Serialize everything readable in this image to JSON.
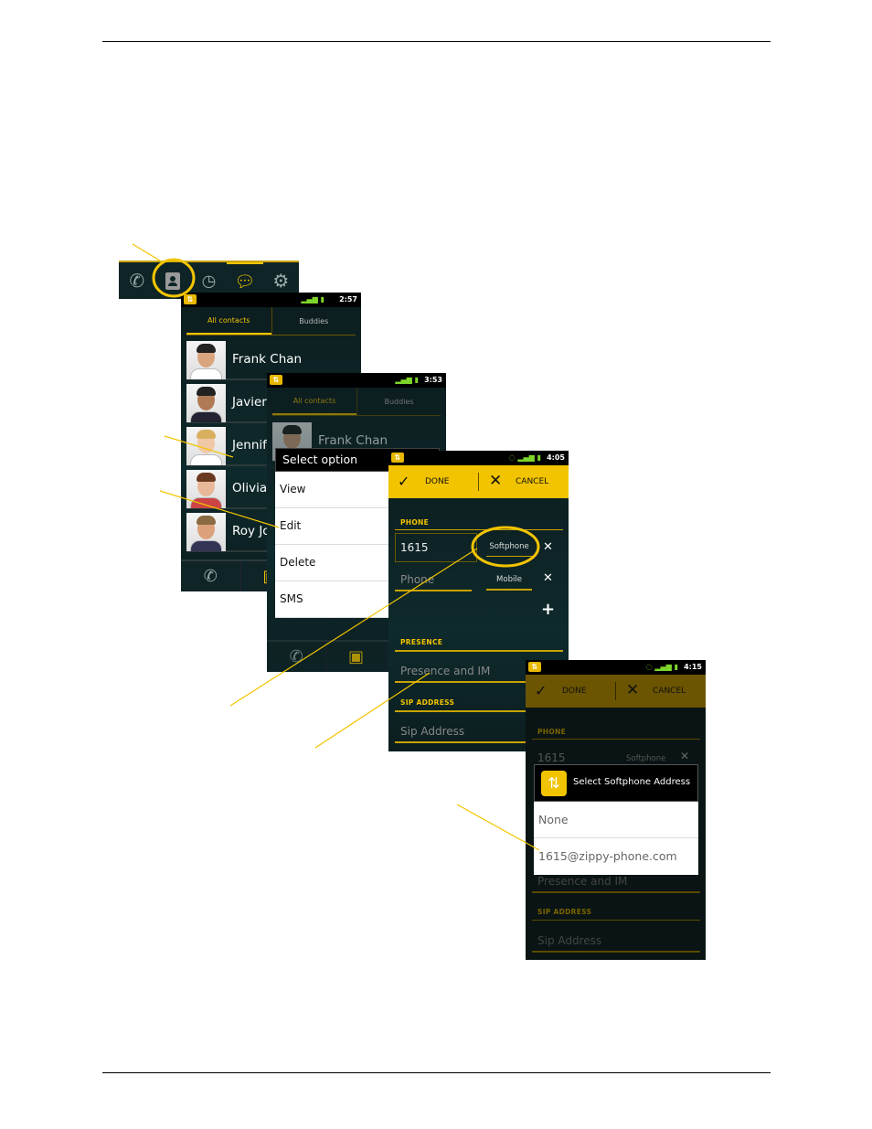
{
  "colors": {
    "accent": "#f2c400",
    "screen_bg": "#0f2a2c",
    "callout": "#f2c400"
  },
  "tabbar": {
    "icons": [
      "phone-icon",
      "contacts-icon",
      "history-icon",
      "chat-icon",
      "gear-icon"
    ]
  },
  "screen1": {
    "time": "2:57",
    "tabs": [
      "All contacts",
      "Buddies"
    ],
    "contacts": [
      "Frank Chan",
      "Javier",
      "Jennife",
      "Olivia ",
      "Roy Jo"
    ]
  },
  "screen2": {
    "time": "3:53",
    "tabs": [
      "All contacts",
      "Buddies"
    ],
    "contact": "Frank Chan",
    "dialog": {
      "title": "Select option",
      "items": [
        "View",
        "Edit",
        "Delete",
        "SMS"
      ]
    }
  },
  "screen3": {
    "time": "4:05",
    "done": "DONE",
    "cancel": "CANCEL",
    "phone_label": "PHONE",
    "phone_value": "1615",
    "phone_type": "Softphone",
    "phone_placeholder": "Phone",
    "phone_type2": "Mobile",
    "presence_label": "PRESENCE",
    "presence_placeholder": "Presence and IM",
    "sip_label": "SIP ADDRESS",
    "sip_placeholder": "Sip Address"
  },
  "screen4": {
    "time": "4:15",
    "done": "DONE",
    "cancel": "CANCEL",
    "phone_label": "PHONE",
    "phone_value": "1615",
    "phone_type": "Softphone",
    "presence_placeholder": "Presence and IM",
    "sip_label": "SIP ADDRESS",
    "sip_placeholder": "Sip Address",
    "dialog": {
      "title": "Select Softphone Address",
      "options": [
        "None",
        "1615@zippy-phone.com"
      ]
    }
  }
}
